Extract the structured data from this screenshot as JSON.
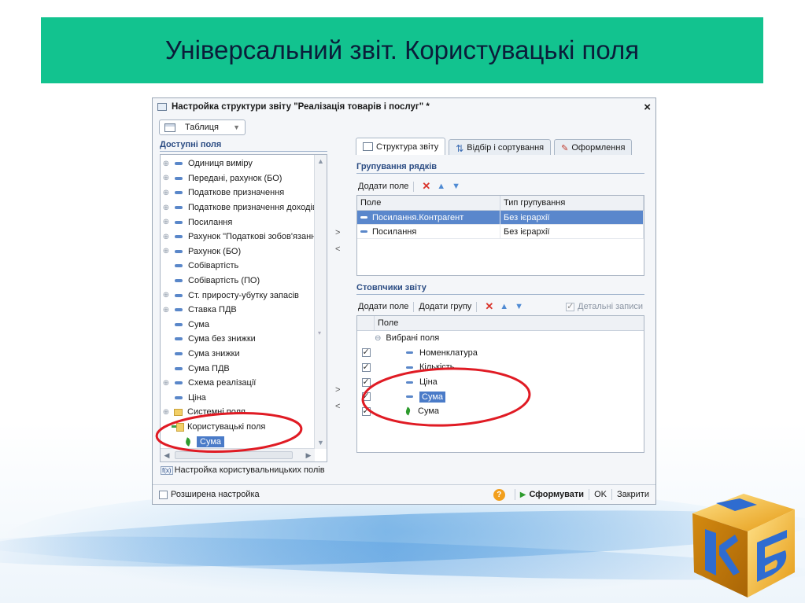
{
  "slide": {
    "title": "Універсальний звіт. Користувацькі поля"
  },
  "colors": {
    "banner": "#12c38f",
    "selection": "#4a7bc8",
    "annotation": "#e01b24"
  },
  "dialog": {
    "title": "Настройка структури звіту \"Реалізація товарів і послуг\" *",
    "close": "×",
    "view_mode": "Таблиця",
    "available_fields_title": "Доступні поля",
    "available_fields": [
      {
        "label": "Одиниця виміру",
        "expandable": true
      },
      {
        "label": "Передані, рахунок (БО)",
        "expandable": true
      },
      {
        "label": "Податкове призначення",
        "expandable": true
      },
      {
        "label": "Податкове призначення доходів",
        "expandable": true
      },
      {
        "label": "Посилання",
        "expandable": true
      },
      {
        "label": "Рахунок \"Податкові зобов'язання\"",
        "expandable": true
      },
      {
        "label": "Рахунок (БО)",
        "expandable": true
      },
      {
        "label": "Собівартість",
        "expandable": false
      },
      {
        "label": "Собівартість (ПО)",
        "expandable": false
      },
      {
        "label": "Ст. приросту-убутку запасів",
        "expandable": true
      },
      {
        "label": "Ставка ПДВ",
        "expandable": true
      },
      {
        "label": "Сума",
        "expandable": false
      },
      {
        "label": "Сума без знижки",
        "expandable": false
      },
      {
        "label": "Сума знижки",
        "expandable": false
      },
      {
        "label": "Сума ПДВ",
        "expandable": false
      },
      {
        "label": "Схема реалізації",
        "expandable": true
      },
      {
        "label": "Ціна",
        "expandable": false
      },
      {
        "label": "Системні поля",
        "expandable": true,
        "folder": true
      },
      {
        "label": "Користувацькі поля",
        "expandable": false,
        "user_folder": true
      },
      {
        "label": "Сума",
        "expandable": false,
        "custom_leaf": true,
        "selected": true
      }
    ],
    "move_right": ">",
    "move_left": "<",
    "custom_fields_link": "Настройка користувальницьких полів",
    "tabs": {
      "structure": "Структура звіту",
      "filter": "Відбір і сортування",
      "design": "Оформлення"
    },
    "row_grouping_title": "Групування рядків",
    "add_field": "Додати поле",
    "add_group": "Додати групу",
    "grouping_table": {
      "headers": [
        "Поле",
        "Тип групування"
      ],
      "rows": [
        {
          "field": "Посилання.Контрагент",
          "type": "Без ієрархії",
          "selected": true
        },
        {
          "field": "Посилання",
          "type": "Без ієрархії",
          "selected": false
        }
      ]
    },
    "report_columns_title": "Стовпчики звіту",
    "detail_records": "Детальні записи",
    "columns_header": "Поле",
    "columns": {
      "group": "Вибрані поля",
      "items": [
        {
          "label": "Номенклатура",
          "checked": true
        },
        {
          "label": "Кількість",
          "checked": true
        },
        {
          "label": "Ціна",
          "checked": true
        },
        {
          "label": "Сума",
          "checked": true,
          "selected": true
        },
        {
          "label": "Сума",
          "checked": true,
          "custom": true
        }
      ]
    },
    "footer": {
      "advanced": "Розширена настройка",
      "help": "?",
      "generate": "Сформувати",
      "ok": "OK",
      "close": "Закрити"
    }
  }
}
